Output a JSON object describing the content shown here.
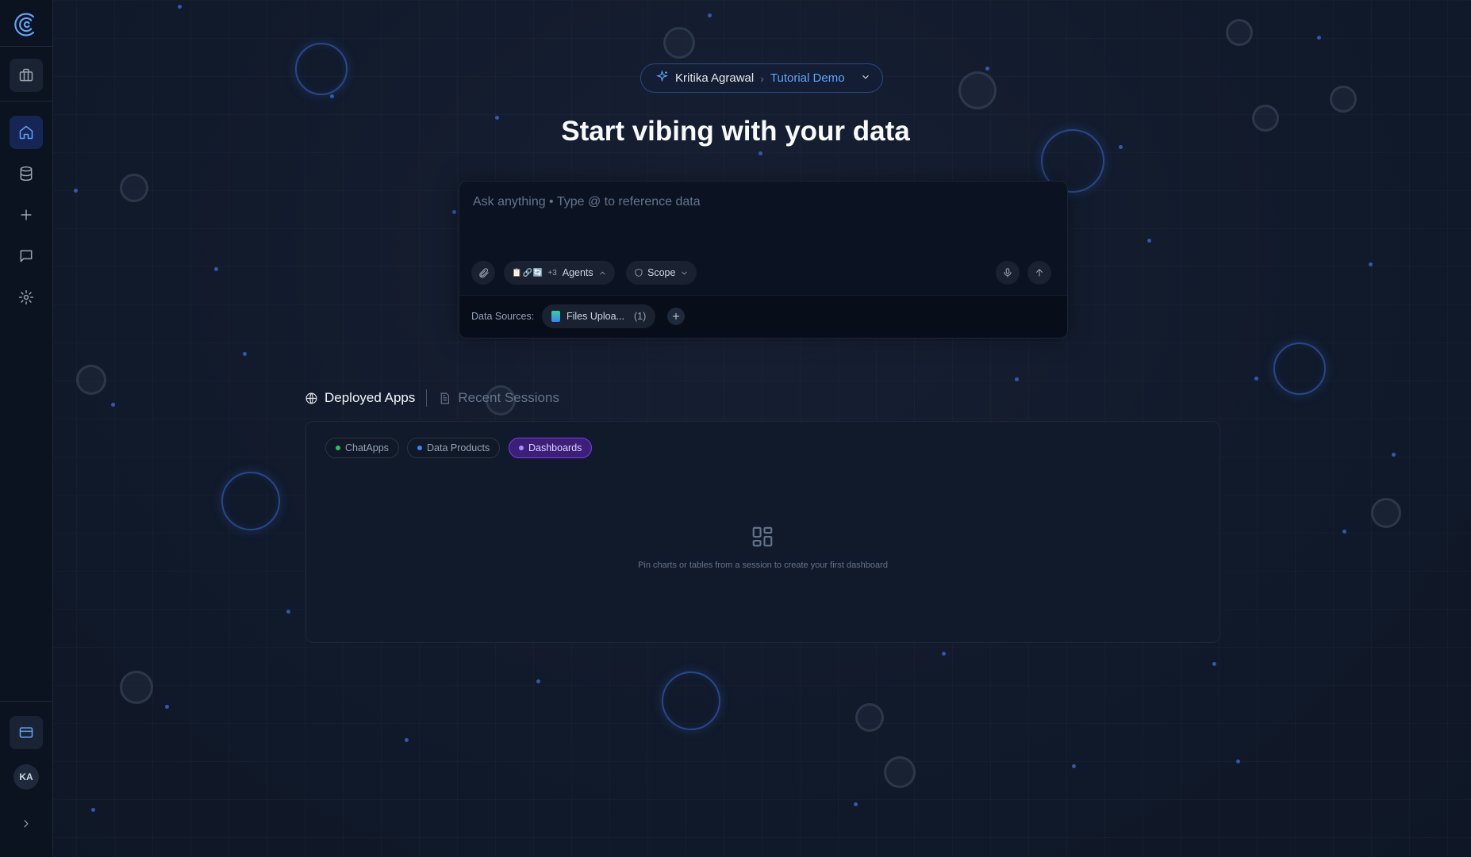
{
  "app": {
    "logo": "c-logo-icon"
  },
  "sidebar": {
    "items": [
      {
        "name": "briefcase",
        "icon": "briefcase-icon"
      },
      {
        "name": "home",
        "icon": "home-icon",
        "active": true
      },
      {
        "name": "database",
        "icon": "database-icon"
      },
      {
        "name": "new",
        "icon": "plus-icon"
      },
      {
        "name": "chat",
        "icon": "message-icon"
      },
      {
        "name": "settings",
        "icon": "gear-icon"
      }
    ],
    "billing_icon": "credit-card-icon",
    "avatar_initials": "KA",
    "expand_icon": "chevron-right-icon"
  },
  "header": {
    "user": "Kritika Agrawal",
    "separator": "›",
    "project": "Tutorial Demo",
    "title": "Start vibing with your data"
  },
  "composer": {
    "placeholder": "Ask anything • Type @ to reference data",
    "agents_icons": "📋🔗🔄",
    "agents_more": "+3",
    "agents_label": "Agents",
    "scope_label": "Scope",
    "data_sources_label": "Data Sources:",
    "data_source_name": "Files Uploa...",
    "data_source_count": "(1)"
  },
  "tabs": {
    "deployed": "Deployed Apps",
    "recent": "Recent Sessions"
  },
  "filters": [
    {
      "label": "ChatApps",
      "color": "#22c55e"
    },
    {
      "label": "Data Products",
      "color": "#3b82f6"
    },
    {
      "label": "Dashboards",
      "color": "#a78bfa",
      "active": true
    }
  ],
  "empty_state": {
    "icon": "dashboard-grid-icon",
    "text": "Pin charts or tables from a session to create your first dashboard"
  },
  "colors": {
    "accent": "#60a5fa",
    "background": "#111827",
    "active_filter": "#7c3aed"
  }
}
